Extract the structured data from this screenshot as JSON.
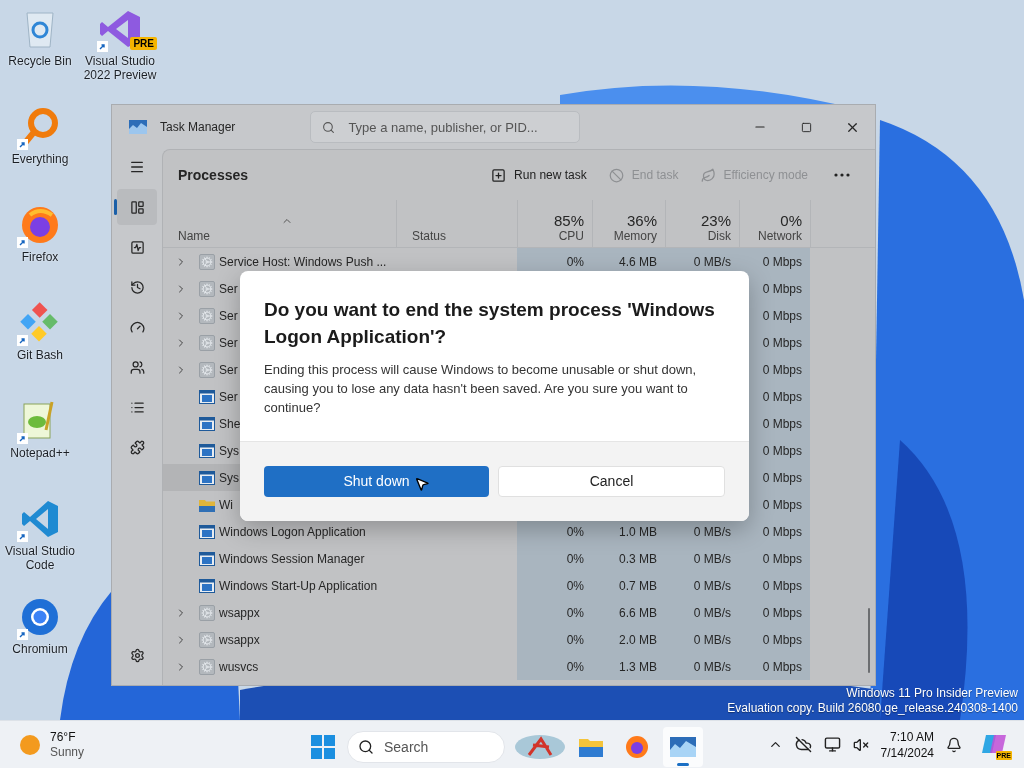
{
  "desktop": {
    "icon_columns": [
      [
        {
          "kind": "recycle-bin",
          "label": "Recycle Bin",
          "shortcut": false
        },
        {
          "kind": "everything",
          "label": "Everything",
          "shortcut": true
        },
        {
          "kind": "firefox",
          "label": "Firefox",
          "shortcut": true
        },
        {
          "kind": "git-bash",
          "label": "Git Bash",
          "shortcut": true
        },
        {
          "kind": "notepad",
          "label": "Notepad++",
          "shortcut": true
        },
        {
          "kind": "vscode",
          "label": "Visual Studio Code",
          "shortcut": true
        },
        {
          "kind": "chromium",
          "label": "Chromium",
          "shortcut": true
        }
      ],
      [
        {
          "kind": "visual-studio",
          "label": "Visual Studio 2022 Preview",
          "badge": "PRE",
          "shortcut": true
        }
      ]
    ],
    "watermark": [
      "Windows 11 Pro Insider Preview",
      "Evaluation copy. Build 26080.ge_release.240308-1400"
    ]
  },
  "task_manager": {
    "title": "Task Manager",
    "search": {
      "placeholder": "Type a name, publisher, or PID..."
    },
    "nav": [
      {
        "kind": "processes",
        "selected": true
      },
      {
        "kind": "performance",
        "selected": false
      },
      {
        "kind": "app-history",
        "selected": false
      },
      {
        "kind": "startup",
        "selected": false
      },
      {
        "kind": "users",
        "selected": false
      },
      {
        "kind": "details",
        "selected": false
      },
      {
        "kind": "services",
        "selected": false
      },
      {
        "kind": "settings",
        "selected": false
      }
    ],
    "heading": "Processes",
    "actions": [
      {
        "kind": "run",
        "label": "Run new task",
        "disabled": false
      },
      {
        "kind": "end",
        "label": "End task",
        "disabled": true
      },
      {
        "kind": "efficiency",
        "label": "Efficiency mode",
        "disabled": true
      }
    ],
    "columns": [
      {
        "label": "Name",
        "sorted": true
      },
      {
        "label": "Status",
        "sorted": false
      },
      {
        "label": "CPU",
        "total": "85%",
        "sorted": false
      },
      {
        "label": "Memory",
        "total": "36%",
        "sorted": false
      },
      {
        "label": "Disk",
        "total": "23%",
        "sorted": false
      },
      {
        "label": "Network",
        "total": "0%",
        "sorted": false
      }
    ],
    "rows": [
      {
        "name": "Service Host: Windows Push ...",
        "kind": "service",
        "expandable": true,
        "selected": false,
        "cpu": "0%",
        "memory": "4.6 MB",
        "disk": "0 MB/s",
        "network": "0 Mbps"
      },
      {
        "name": "Ser",
        "kind": "service",
        "expandable": true,
        "selected": false,
        "network": "0 Mbps"
      },
      {
        "name": "Ser",
        "kind": "service",
        "expandable": true,
        "selected": false,
        "network": "0 Mbps"
      },
      {
        "name": "Ser",
        "kind": "service",
        "expandable": true,
        "selected": false,
        "network": "0 Mbps"
      },
      {
        "name": "Ser",
        "kind": "service",
        "expandable": true,
        "selected": false,
        "network": "0 Mbps"
      },
      {
        "name": "Ser",
        "kind": "app",
        "expandable": false,
        "selected": false,
        "network": "0 Mbps"
      },
      {
        "name": "She",
        "kind": "app",
        "expandable": false,
        "selected": false,
        "network": "0 Mbps"
      },
      {
        "name": "Sys",
        "kind": "app",
        "expandable": false,
        "selected": false,
        "network": "0 Mbps"
      },
      {
        "name": "Sys",
        "kind": "app",
        "expandable": false,
        "selected": true,
        "network": "0 Mbps"
      },
      {
        "name": "Wi",
        "kind": "folder",
        "expandable": false,
        "selected": false,
        "network": "0 Mbps"
      },
      {
        "name": "Windows Logon Application",
        "kind": "app",
        "expandable": false,
        "selected": false,
        "cpu": "0%",
        "memory": "1.0 MB",
        "disk": "0 MB/s",
        "network": "0 Mbps"
      },
      {
        "name": "Windows Session Manager",
        "kind": "app",
        "expandable": false,
        "selected": false,
        "cpu": "0%",
        "memory": "0.3 MB",
        "disk": "0 MB/s",
        "network": "0 Mbps"
      },
      {
        "name": "Windows Start-Up Application",
        "kind": "app",
        "expandable": false,
        "selected": false,
        "cpu": "0%",
        "memory": "0.7 MB",
        "disk": "0 MB/s",
        "network": "0 Mbps"
      },
      {
        "name": "wsappx",
        "kind": "service",
        "expandable": true,
        "selected": false,
        "cpu": "0%",
        "memory": "6.6 MB",
        "disk": "0 MB/s",
        "network": "0 Mbps"
      },
      {
        "name": "wsappx",
        "kind": "service",
        "expandable": true,
        "selected": false,
        "cpu": "0%",
        "memory": "2.0 MB",
        "disk": "0 MB/s",
        "network": "0 Mbps"
      },
      {
        "name": "wusvcs",
        "kind": "service",
        "expandable": true,
        "selected": false,
        "cpu": "0%",
        "memory": "1.3 MB",
        "disk": "0 MB/s",
        "network": "0 Mbps"
      }
    ]
  },
  "dialog": {
    "title": "Do you want to end the system process 'Windows Logon Application'?",
    "message": "Ending this process will cause Windows to become unusable or shut down, causing you to lose any data hasn't been saved. Are you sure you want to continue?",
    "buttons": [
      {
        "label": "Shut down",
        "primary": true
      },
      {
        "label": "Cancel",
        "primary": false
      }
    ]
  },
  "taskbar": {
    "weather": {
      "temperature": "76°F",
      "condition": "Sunny"
    },
    "search": {
      "placeholder": "Search"
    },
    "apps": [
      {
        "kind": "file-explorer",
        "active": false
      },
      {
        "kind": "firefox",
        "active": false
      },
      {
        "kind": "task-manager",
        "active": true
      }
    ],
    "clock": {
      "time": "7:10 AM",
      "date": "7/14/2024"
    },
    "copilot_badge": "PRE"
  }
}
